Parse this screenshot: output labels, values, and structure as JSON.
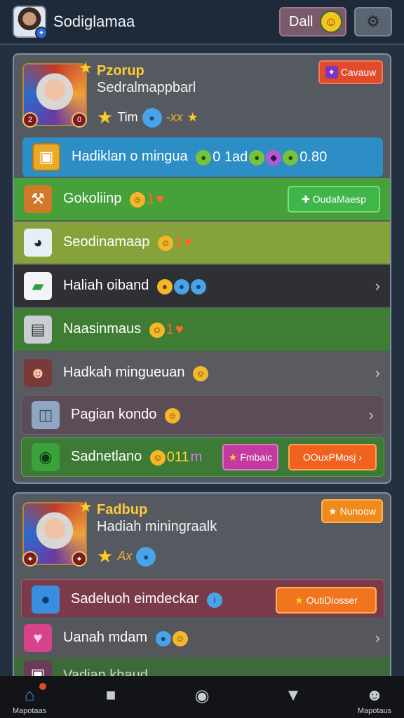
{
  "header": {
    "app_title": "Sodiglamaa",
    "deal_label": "Dall",
    "deal_icon": "smile-icon",
    "settings_icon": "gear-icon"
  },
  "panel1": {
    "name": "Pzorup",
    "subtitle": "Sedralmappbarl",
    "stat_text": "Tim",
    "stat_extra": "-xx",
    "level_left": "2",
    "level_right": "0",
    "tag": "Cavauw",
    "rows": [
      {
        "label": "Hadiklan o mingua",
        "extra": "0 1ad",
        "extra2": "0.80",
        "icon": "chest-icon"
      },
      {
        "label": "Gokoliinp",
        "heart": "1",
        "button": "OudaMaesp",
        "icon": "hammer-icon"
      },
      {
        "label": "Seodinamaap",
        "heart": "1",
        "icon": "panda-icon"
      },
      {
        "label": "Haliah oiband",
        "icon": "box-icon"
      },
      {
        "label": "Naasinmaus",
        "heart": "1",
        "icon": "machine-icon"
      },
      {
        "label": "Hadkah mingueuan",
        "icon": "girl-avatar-icon"
      },
      {
        "label": "Pagian kondo",
        "icon": "cube-icon"
      },
      {
        "label": "Sadnetlano",
        "extra": "011",
        "extra2": "m",
        "button_pink": "Fmbaic",
        "button_orange": "OOuxPMosj"
      }
    ]
  },
  "panel2": {
    "name": "Fadbup",
    "subtitle": "Hadiah miningraalk",
    "stat_extra": "Ax",
    "tag": "Nunoow",
    "rows": [
      {
        "label": "Sadeluoh eimdeckar",
        "button": "OutiDiosser",
        "icon": "blob-icon"
      },
      {
        "label": "Uanah mdam",
        "icon": "heart-box-icon"
      },
      {
        "label": "Vadian khaud"
      }
    ]
  },
  "nav": {
    "home_label": "Mapotaas",
    "right_label": "Mapotaus"
  },
  "colors": {
    "background": "#24303f",
    "panel": "#555a61",
    "accent_gold": "#ffc93a",
    "accent_green": "#3fb54a",
    "accent_orange": "#f0621f"
  }
}
